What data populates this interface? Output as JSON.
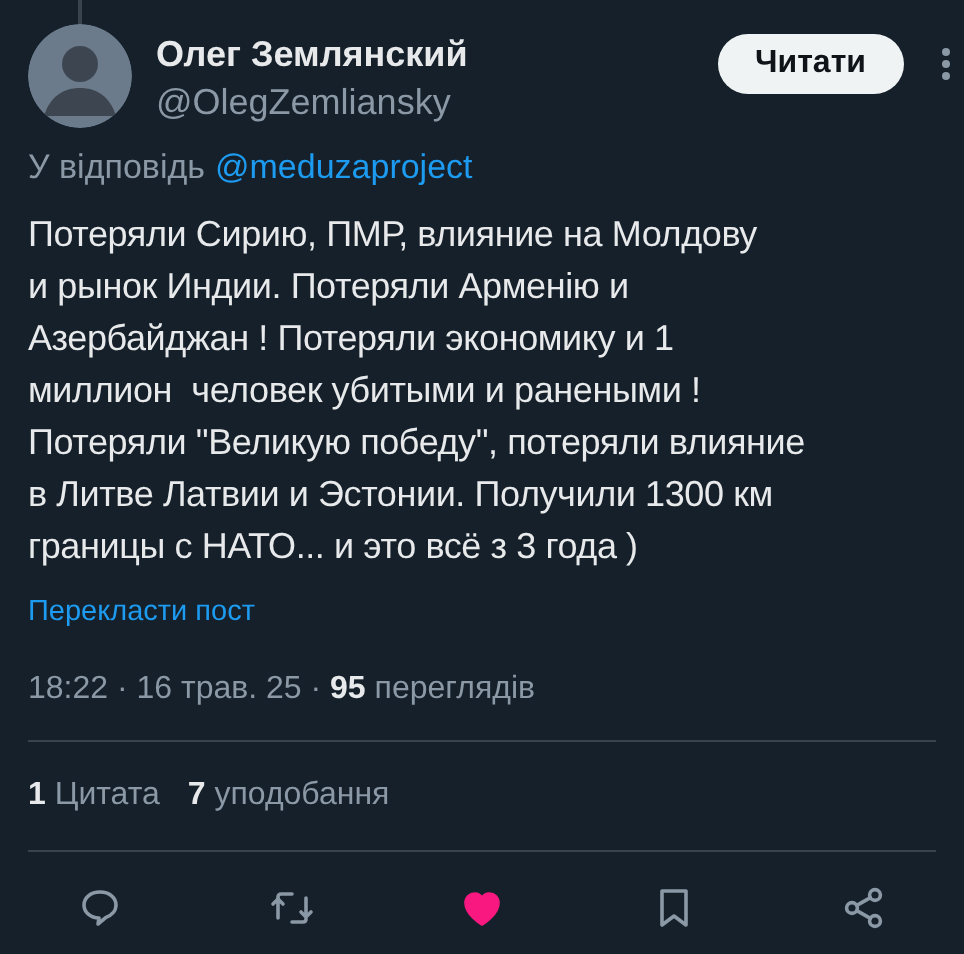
{
  "author": {
    "name": "Олег Землянский",
    "handle": "@OlegZemliansky"
  },
  "follow_button": "Читати",
  "reply_to": {
    "label": "У відповідь",
    "mention": "@meduzaproject"
  },
  "body": "Потеряли Сирию, ПМР, влияние на Молдову\nи рынок Индии. Потеряли Арменію и\nАзербайджан ! Потеряли экономику и 1\nмиллион  человек убитыми и ранеными !\nПотеряли \"Великую победу\", потеряли влияние\nв Литве Латвии и Эстонии. Получили 1300 км\nграницы с НАТО... и это всё з 3 года )",
  "translate_link": "Перекласти пост",
  "meta": "18:22 · 16 трав. 25 · **95** переглядів",
  "stats": [
    "**1** Цитата",
    "**7** уподобання"
  ],
  "actions": [
    {
      "kind": "reply",
      "on": false
    },
    {
      "kind": "repost",
      "on": false
    },
    {
      "kind": "like",
      "on": true
    },
    {
      "kind": "bookmark",
      "on": false
    },
    {
      "kind": "share",
      "on": false
    }
  ]
}
